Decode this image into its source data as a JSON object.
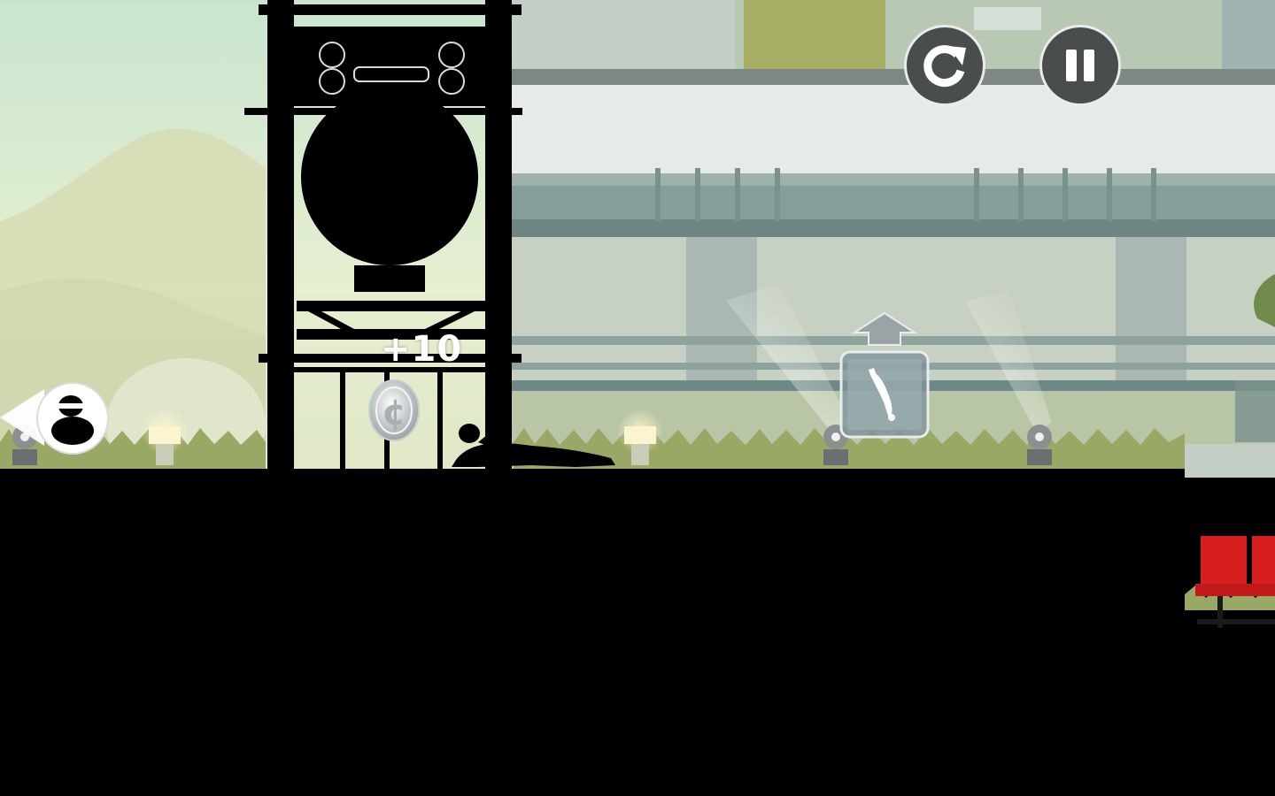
{
  "hud": {
    "restart_icon": "restart-icon",
    "pause_icon": "pause-icon"
  },
  "popups": {
    "coin_reward": "+10"
  },
  "items": {
    "coin_symbol": "¢",
    "powerup_icon": "diving-figure-icon",
    "powerup_hint_icon": "up-arrow-icon"
  },
  "player": {
    "indicator_icon": "offscreen-player-icon"
  },
  "colors": {
    "sky_top": "#cfe6d2",
    "sky_bottom": "#e9efd0",
    "building_frame": "#7f8b86",
    "grass": "#9aa866",
    "hud_button": "#4a4d4e",
    "hud_border": "#e8ecec",
    "seat_red": "#d81f1f"
  }
}
